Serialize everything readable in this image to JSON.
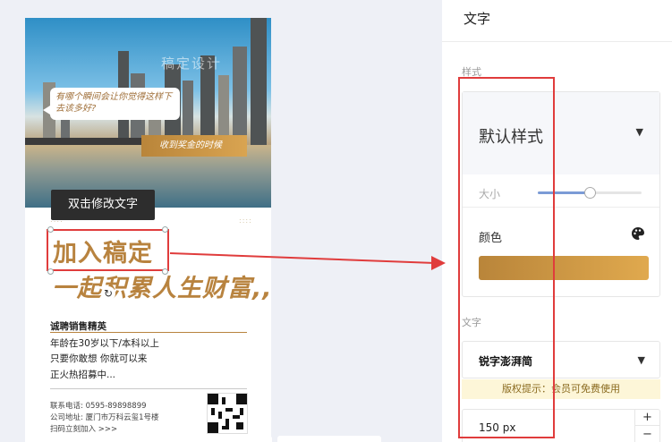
{
  "poster": {
    "watermark": "稿定设计",
    "bubble_text": "有哪个瞬间会让你觉得这样下去该多好?",
    "banner_text": "收到奖金的时候",
    "tooltip": "双击修改文字",
    "headline1": "加入稿定",
    "headline2": "一起积累人生财富,,",
    "recruit_title": "诚聘销售精英",
    "requirements": [
      "年龄在30岁以下/本科以上",
      "只要你敢想 你就可以来",
      "正火热招募中..."
    ],
    "contact_phone": "联系电话: 0595-89898899",
    "contact_address": "公司地址: 厦门市万科云玺1号楼",
    "scan_text": "扫码立刻加入 >>>"
  },
  "panel": {
    "title": "文字",
    "style_section": "样式",
    "style_value": "默认样式",
    "size_label": "大小",
    "size_slider_fraction": 0.5,
    "color_label": "颜色",
    "color_start": "#b9853a",
    "color_end": "#e0a94e",
    "font_section": "文字",
    "font_value": "锐字澎湃简",
    "copyright_notice": "版权提示：会员可免费使用",
    "font_size_value": "150 px",
    "step_plus": "+",
    "step_minus": "−"
  },
  "icons": {
    "caret": "▼",
    "rotate": "↻",
    "palette": "palette-icon"
  },
  "accent_red": "#e03c3c",
  "brand_gold": "#b8833f"
}
